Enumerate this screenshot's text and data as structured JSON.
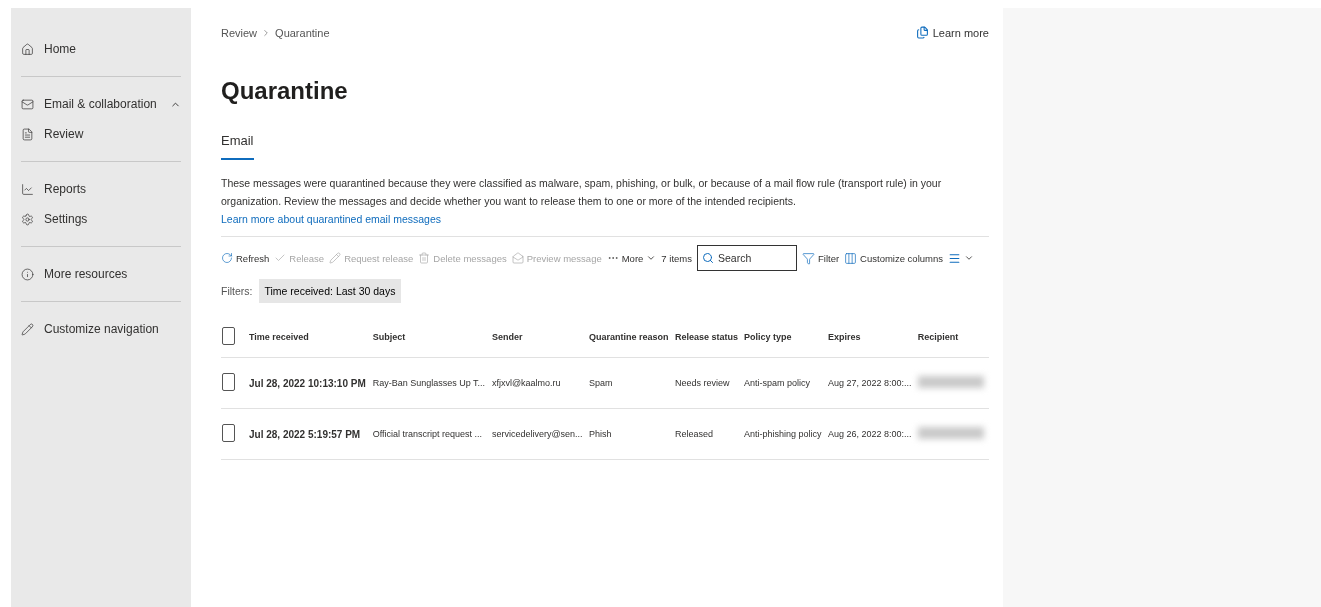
{
  "sidebar": {
    "items": [
      {
        "label": "Home"
      },
      {
        "label": "Email & collaboration",
        "expanded": true
      },
      {
        "label": "Review"
      },
      {
        "label": "Reports"
      },
      {
        "label": "Settings"
      },
      {
        "label": "More resources"
      },
      {
        "label": "Customize navigation"
      }
    ]
  },
  "breadcrumb": [
    "Review",
    "Quarantine"
  ],
  "learn_more": "Learn more",
  "title": "Quarantine",
  "tabs": [
    {
      "label": "Email",
      "selected": true
    }
  ],
  "description": {
    "text": "These messages were quarantined because they were classified as malware, spam, phishing, or bulk, or because of a mail flow rule (transport rule) in your organization. Review the messages and decide whether you want to release them to one or more of the intended recipients.",
    "link": "Learn more about quarantined email messages"
  },
  "toolbar": {
    "actions": [
      {
        "label": "Refresh",
        "disabled": false
      },
      {
        "label": "Release",
        "disabled": true
      },
      {
        "label": "Request release",
        "disabled": true
      },
      {
        "label": "Delete messages",
        "disabled": true
      },
      {
        "label": "Preview message",
        "disabled": true
      },
      {
        "label": "More",
        "disabled": false
      }
    ],
    "count": "7 items",
    "search": {
      "placeholder": "Search"
    },
    "filter": "Filter",
    "customize": "Customize columns"
  },
  "filters": {
    "label": "Filters:",
    "chips": [
      "Time received: Last 30 days"
    ]
  },
  "table": {
    "select_all_checked": false,
    "columns": [
      "Time received",
      "Subject",
      "Sender",
      "Quarantine reason",
      "Release status",
      "Policy type",
      "Expires",
      "Recipient"
    ],
    "rows": [
      {
        "checked": false,
        "cells": [
          "Jul 28, 2022 10:13:10 PM",
          "Ray-Ban Sunglasses Up T...",
          "xfjxvl@kaalmo.ru",
          "Spam",
          "Needs review",
          "Anti-spam policy",
          "Aug 27, 2022 8:00:..."
        ]
      },
      {
        "checked": false,
        "cells": [
          "Jul 28, 2022 5:19:57 PM",
          "Official transcript request ...",
          "servicedelivery@sen...",
          "Phish",
          "Released",
          "Anti-phishing policy",
          "Aug 26, 2022 8:00:..."
        ]
      }
    ]
  }
}
